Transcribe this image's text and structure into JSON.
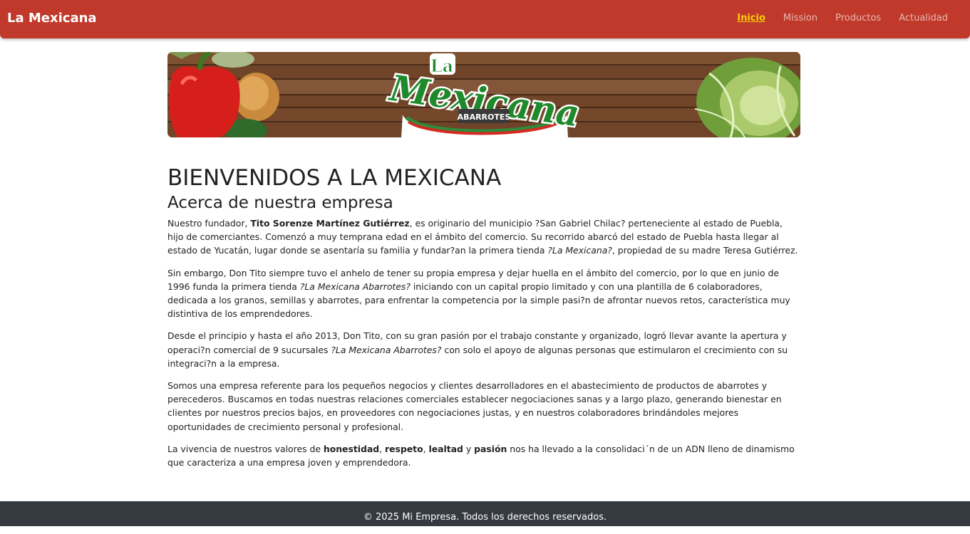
{
  "nav": {
    "brand": "La Mexicana",
    "links": [
      "Inicio",
      "Mission",
      "Productos",
      "Actualidad"
    ],
    "active_color": "#f5d000",
    "bar_color": "#c0392b"
  },
  "banner": {
    "logo_top": "La",
    "logo_main": "Mexicana",
    "logo_sub": "ABARROTES"
  },
  "main": {
    "title": "BIENVENIDOS A LA MEXICANA",
    "subtitle": "Acerca de nuestra empresa",
    "p1": {
      "a": "Nuestro fundador, ",
      "b": "Tito Sorenze Martínez Gutiérrez",
      "c": ", es originario del municipio ?San Gabriel Chilac? perteneciente al estado de Puebla, hijo de comerciantes. Comenzó a muy temprana edad en el ámbito del comercio. Su recorrido abarcó del estado de Puebla hasta llegar al estado de Yucatán, lugar donde se asentaría su familia y fundar?an la primera tienda ",
      "d": "?La Mexicana?",
      "e": ", propiedad de su madre Teresa Gutiérrez."
    },
    "p2": {
      "a": "Sin embargo, Don Tito siempre tuvo el anhelo de tener su propia empresa y dejar huella en el ámbito del comercio, por lo que en junio de 1996 funda la primera tienda ",
      "b": "?La Mexicana Abarrotes?",
      "c": " iniciando con un capital propio limitado y con una plantilla de 6 colaboradores, dedicada a los granos, semillas y abarrotes, para enfrentar la competencia por la simple pasi?n de afrontar nuevos retos, característica muy distintiva de los emprendedores."
    },
    "p3": {
      "a": "Desde el principio y hasta el año 2013, Don Tito, con su gran pasión por el trabajo constante y organizado, logró llevar avante la apertura y operaci?n comercial de 9 sucursales ",
      "b": "?La Mexicana Abarrotes?",
      "c": " con solo el apoyo de algunas personas que estimularon el crecimiento con su integraci?n a la empresa."
    },
    "p4": "Somos una empresa referente para los pequeños negocios y clientes desarrolladores en el abastecimiento de productos de abarrotes y perecederos. Buscamos en todas nuestras relaciones comerciales establecer negociaciones sanas y a largo plazo, generando bienestar en clientes por nuestros precios bajos, en proveedores con negociaciones justas, y en nuestros colaboradores brindándoles mejores oportunidades de crecimiento personal y profesional.",
    "p5": {
      "a": "La vivencia de nuestros valores de ",
      "v1": "honestidad",
      "s1": ", ",
      "v2": "respeto",
      "s2": ", ",
      "v3": "lealtad",
      "s3": " y ",
      "v4": "pasión",
      "b": " nos ha llevado a la consolidaci´n de un ADN lleno de dinamismo que caracteriza a una empresa joven y emprendedora."
    }
  },
  "footer": {
    "text": "© 2025 Mi Empresa. Todos los derechos reservados."
  }
}
